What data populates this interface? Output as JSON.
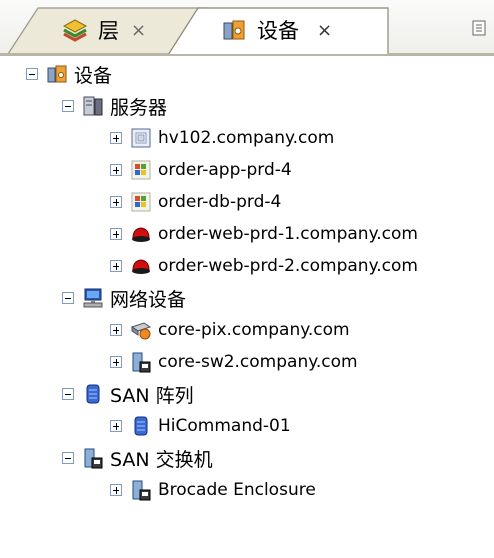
{
  "tabs": [
    {
      "label": "层",
      "close": "×",
      "icon": "layers-icon"
    },
    {
      "label": "设备",
      "close": "×",
      "icon": "devices-icon"
    }
  ],
  "tree": {
    "root": {
      "label": "设备",
      "icon": "devices-icon",
      "expanded": true
    },
    "servers": {
      "label": "服务器",
      "icon": "server-icon",
      "items": [
        {
          "label": "hv102.company.com",
          "icon": "virtual-host-icon"
        },
        {
          "label": "order-app-prd-4",
          "icon": "windows-icon"
        },
        {
          "label": "order-db-prd-4",
          "icon": "windows-icon"
        },
        {
          "label": "order-web-prd-1.company.com",
          "icon": "redhat-icon"
        },
        {
          "label": "order-web-prd-2.company.com",
          "icon": "redhat-icon"
        }
      ]
    },
    "network": {
      "label": "网络设备",
      "icon": "network-icon",
      "items": [
        {
          "label": "core-pix.company.com",
          "icon": "router-icon"
        },
        {
          "label": "core-sw2.company.com",
          "icon": "switch-icon"
        }
      ]
    },
    "san_arrays": {
      "label": "SAN 阵列",
      "icon": "storage-icon",
      "items": [
        {
          "label": "HiCommand-01",
          "icon": "storage-icon"
        }
      ]
    },
    "san_switches": {
      "label": "SAN 交换机",
      "icon": "san-switch-icon",
      "items": [
        {
          "label": "Brocade Enclosure",
          "icon": "san-switch-icon"
        }
      ]
    }
  }
}
